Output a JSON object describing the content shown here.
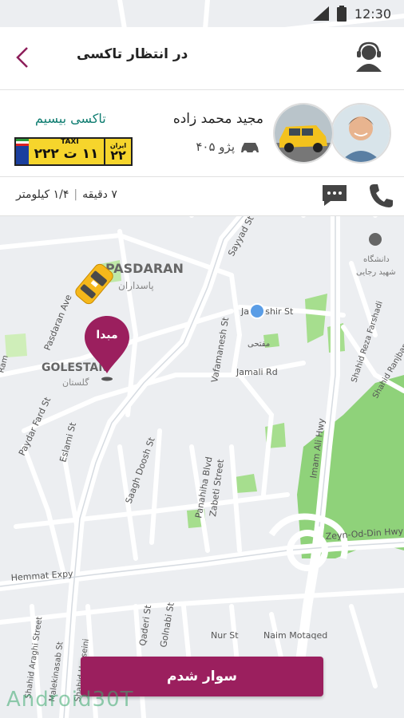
{
  "status_bar": {
    "time": "12:30"
  },
  "header": {
    "title": "در انتظار تاکسی"
  },
  "driver": {
    "name": "مجید محمد زاده",
    "car_model": "پژو ۴۰۵",
    "service": "تاکسی بیسیم"
  },
  "plate": {
    "number": "۱۱ ت ۲۲۲",
    "taxi_label": "TAXI",
    "region_label": "ایران",
    "region_number": "۲۲"
  },
  "trip": {
    "time": "۷ دقیقه",
    "distance": "۱/۴ کیلومتر"
  },
  "map": {
    "origin_label": "مبدا",
    "street_labels": [
      "PASDARAN",
      "پاسداران",
      "Pasdaran Ave",
      "Sayyad St",
      "دانشگاه",
      "شهید رجایی",
      "Javanshir St",
      "مفتحی",
      "Jamali Rd",
      "Vafamanesh St",
      "GOLESTAN",
      "گلستان",
      "Paydar Fard St",
      "Eslami St",
      "Saagh Doosh St",
      "Panahiha Blvd",
      "Zabeti Street",
      "Shahid Reza Farshadi",
      "Shahid Ranjbar",
      "Imam Ali Hwy",
      "Zeyn-Od-Din Hwy",
      "Hemmat Expy",
      "Qaderi St",
      "Golnabi St",
      "Nur St",
      "Naim Motaqed",
      "Shahid Araghi Street",
      "Malekinasab St",
      "Shahid Hosseini",
      "Ram"
    ]
  },
  "confirm_button": {
    "label": "سوار شدم"
  },
  "watermark": "Android30T",
  "colors": {
    "accent": "#9b1f5e",
    "service": "#0f7d71",
    "green_area": "#8fd27a",
    "plate": "#f6d52c"
  }
}
